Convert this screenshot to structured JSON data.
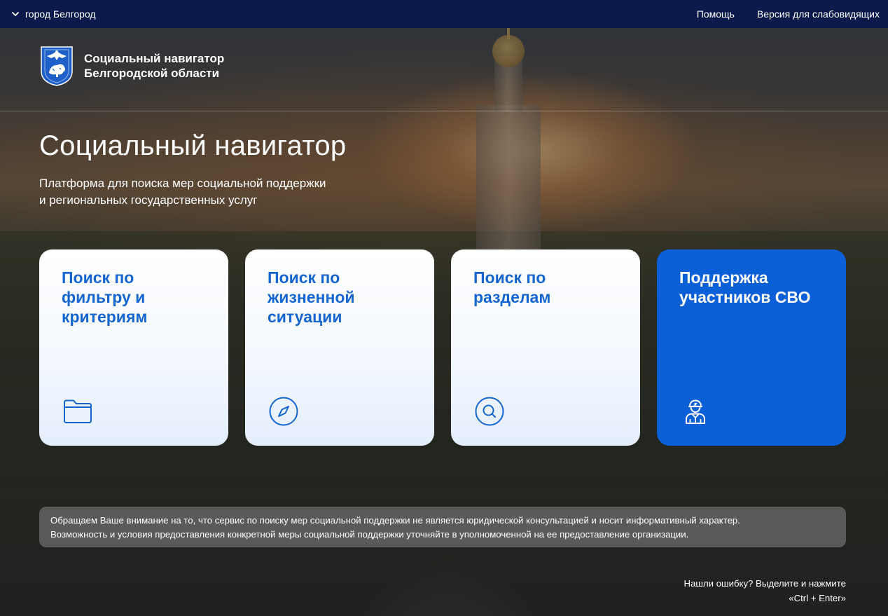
{
  "topbar": {
    "city": "город Белгород",
    "help": "Помощь",
    "accessibility": "Версия для слабовидящих"
  },
  "header": {
    "brand_line1": "Социальный навигатор",
    "brand_line2": "Белгородской области",
    "logo_icon": "belgorod-coat-of-arms-icon"
  },
  "hero": {
    "title": "Социальный навигатор",
    "subtitle_line1": "Платформа для поиска мер социальной поддержки",
    "subtitle_line2": "и региональных государственных услуг"
  },
  "cards": [
    {
      "label": "Поиск по фильтру и критериям",
      "icon": "folder-icon"
    },
    {
      "label": "Поиск по жизненной ситуации",
      "icon": "compass-icon"
    },
    {
      "label": "Поиск по разделам",
      "icon": "search-icon"
    },
    {
      "label": "Поддержка участников СВО",
      "icon": "soldier-icon"
    }
  ],
  "notice": {
    "line1": "Обращаем Ваше внимание на то, что сервис по поиску мер социальной поддержки не является юридической консультацией и носит информативный характер.",
    "line2": "Возможность и условия предоставления конкретной меры социальной поддержки уточняйте в уполномоченной на ее предоставление организации."
  },
  "error_hint": {
    "line1": "Нашли ошибку? Выделите и нажмите",
    "line2": "«Ctrl + Enter»"
  },
  "colors": {
    "topbar": "#0b1a4a",
    "accent": "#1565d0",
    "primary_card": "#0b5fd7"
  }
}
